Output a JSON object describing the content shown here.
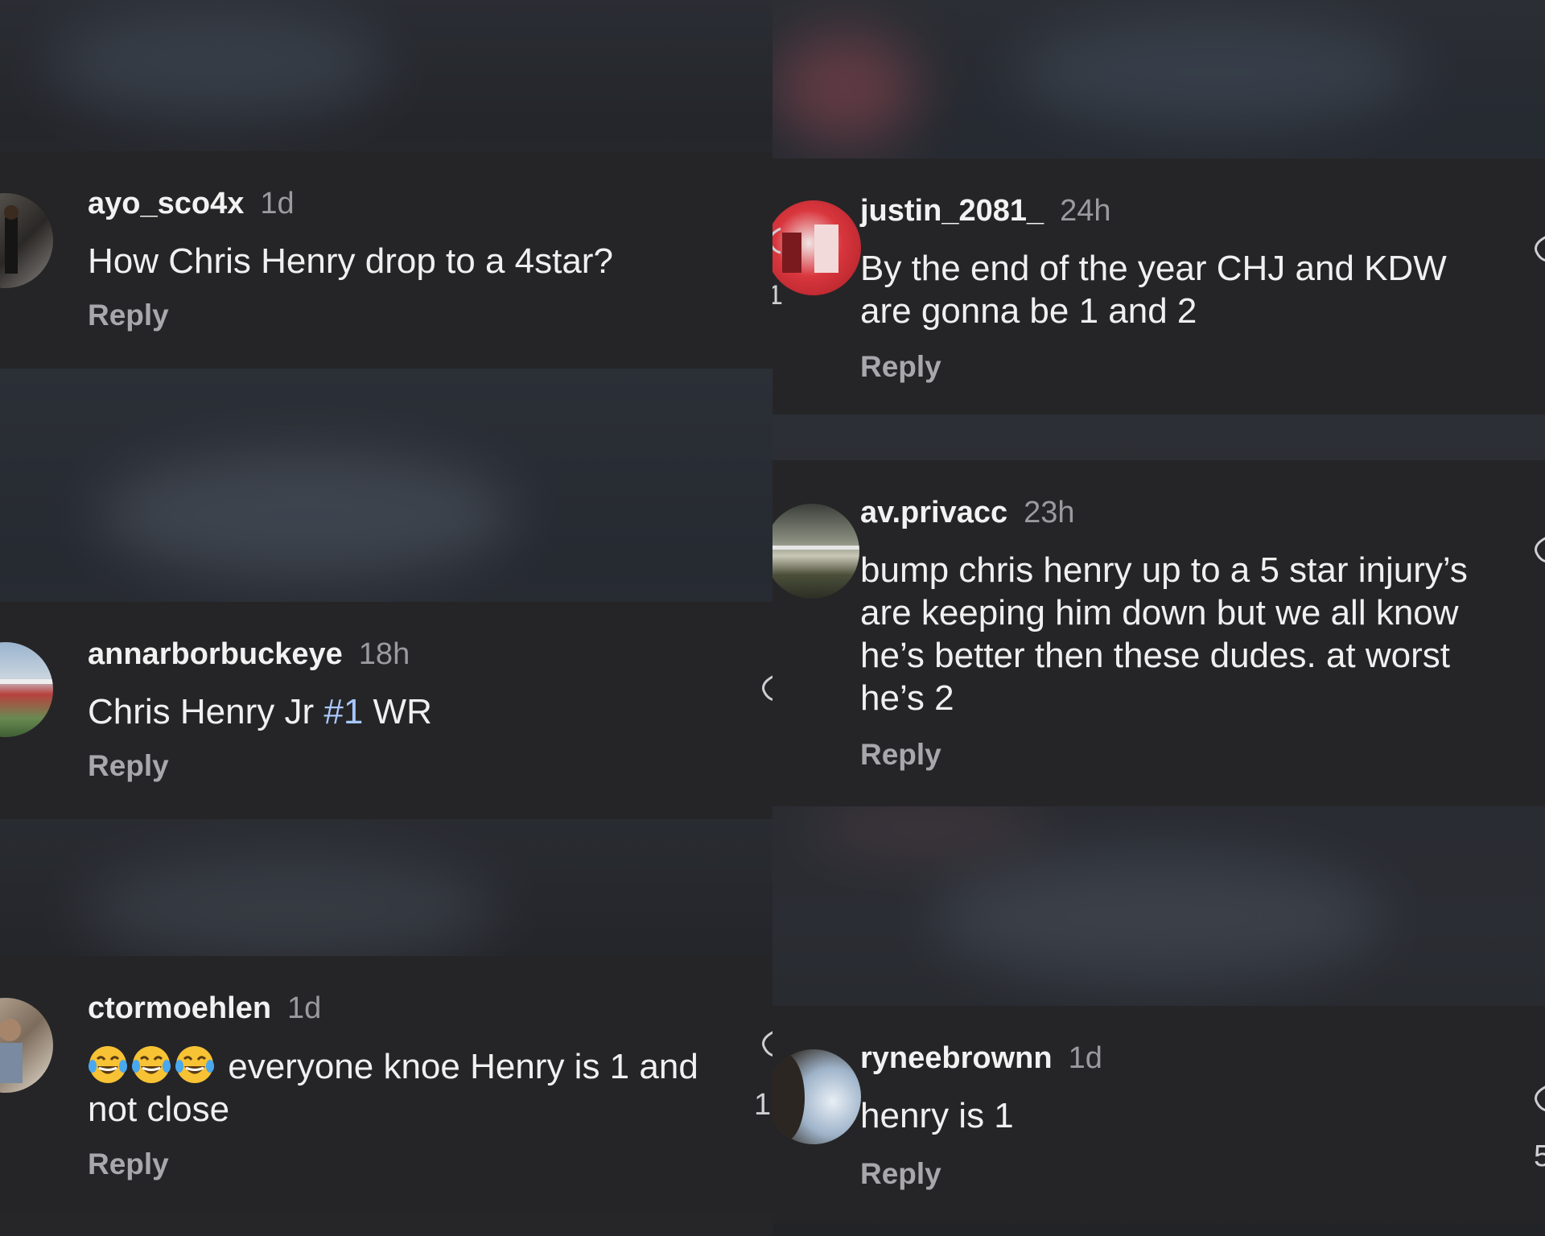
{
  "comments": [
    {
      "user": "ayo_sco4x",
      "time": "1d",
      "text": "How Chris Henry drop to a 4star?",
      "reply": "Reply"
    },
    {
      "user": "annarborbuckeye",
      "time": "18h",
      "text_before": "Chris Henry Jr ",
      "hashtag": "#1",
      "text_after": " WR",
      "reply": "Reply"
    },
    {
      "user": "ctormoehlen",
      "time": "1d",
      "emoji": [
        "😂",
        "😂",
        "😂"
      ],
      "text_line1": " everyone knoe Henry is 1 and",
      "text_line2": "not close",
      "reply": "Reply"
    },
    {
      "user": "justin_2081_",
      "time": "24h",
      "text_line1": "By the end of the year CHJ and KDW",
      "text_line2": "are gonna be 1 and 2",
      "reply": "Reply"
    },
    {
      "user": "av.privacc",
      "time": "23h",
      "lines": [
        "bump chris henry up to a 5 star injury’s",
        "are keeping him down but we all know",
        "he’s better then these dudes. at worst",
        "he’s 2"
      ],
      "reply": "Reply"
    },
    {
      "user": "ryneebrownn",
      "time": "1d",
      "text": "henry is 1",
      "reply": "Reply"
    }
  ],
  "edge_counts": [
    "1",
    "1",
    "5"
  ],
  "colors": {
    "card": "#252527",
    "username": "#f2f2f2",
    "timestamp": "#9a9a9f",
    "reply": "#a8a8ac",
    "hashtag": "#a8c7fa"
  }
}
